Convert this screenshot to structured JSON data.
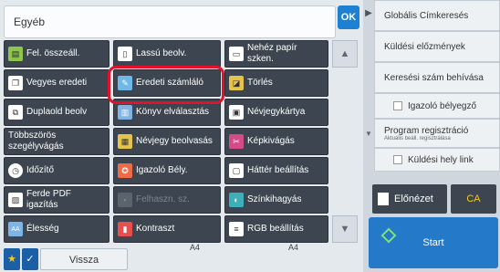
{
  "header": {
    "title": "Egyéb",
    "ok_label": "OK"
  },
  "functions": [
    {
      "label": "Fel. összeáll.",
      "icon": "stack-icon"
    },
    {
      "label": "Lassú beolv.",
      "icon": "document-icon"
    },
    {
      "label": "Nehéz papír szken.",
      "icon": "paper-icon"
    },
    {
      "label": "Vegyes eredeti",
      "icon": "mixed-originals-icon"
    },
    {
      "label": "Eredeti számláló",
      "icon": "counter-icon"
    },
    {
      "label": "Törlés",
      "icon": "eraser-icon"
    },
    {
      "label": "Duplaold beolv",
      "icon": "duplex-icon"
    },
    {
      "label": "Könyv elválasztás",
      "icon": "book-icon"
    },
    {
      "label": "Névjegykártya",
      "icon": "business-card-icon"
    },
    {
      "label": "Többszörös szegélyvágás",
      "icon": "multi-crop-icon"
    },
    {
      "label": "Névjegy beolvasás",
      "icon": "contact-scan-icon"
    },
    {
      "label": "Képkivágás",
      "icon": "crop-icon"
    },
    {
      "label": "Időzítő",
      "icon": "clock-icon"
    },
    {
      "label": "Igazoló Bély.",
      "icon": "stamp-icon"
    },
    {
      "label": "Háttér beállítás",
      "icon": "background-icon"
    },
    {
      "label": "Ferde PDF igazítás",
      "icon": "pdf-skew-icon"
    },
    {
      "label": "Felhaszn. sz.",
      "icon": "user-count-icon"
    },
    {
      "label": "Színkihagyás",
      "icon": "color-drop-icon"
    },
    {
      "label": "Élesség",
      "icon": "sharpness-icon"
    },
    {
      "label": "Kontraszt",
      "icon": "contrast-icon"
    },
    {
      "label": "RGB beállítás",
      "icon": "rgb-icon"
    }
  ],
  "paper": {
    "left": "A4",
    "right": "A4"
  },
  "footer": {
    "back_label": "Vissza"
  },
  "side_panel": {
    "items": [
      {
        "label": "Globális Címkeresés"
      },
      {
        "label": "Küldési előzmények"
      },
      {
        "label": "Keresési szám behívása"
      },
      {
        "label": "Igazoló bélyegző"
      },
      {
        "label": "Program regisztráció",
        "sub": "Aktuális beáll. regisztrálása"
      },
      {
        "label": "Küldési hely link"
      }
    ]
  },
  "actions": {
    "preview_label": "Előnézet",
    "ca_label": "CA",
    "start_label": "Start"
  },
  "colors": {
    "accent": "#1f7fd1",
    "highlight": "#e5102c",
    "start": "#2479c9"
  }
}
